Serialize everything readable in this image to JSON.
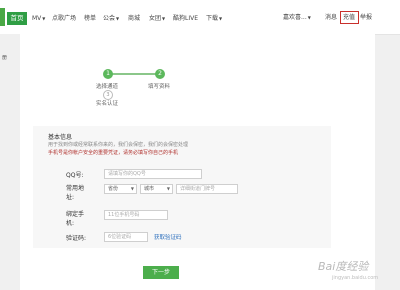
{
  "nav": {
    "home": "首页",
    "items": [
      "MV",
      "点歌广场",
      "榜单",
      "公会",
      "商城",
      "女团",
      "酷狗LIVE",
      "下载"
    ],
    "user": "嘉欢喜...",
    "message": "消息",
    "recharge": "充值",
    "report": "举报"
  },
  "page": {
    "side_label": "册"
  },
  "steps": [
    {
      "num": "1",
      "label": "选择通道"
    },
    {
      "num": "2",
      "label": "填写资料"
    },
    {
      "num": "3",
      "label": "实名认证"
    }
  ],
  "form": {
    "title": "基本信息",
    "desc": "用于找到你或经常联系你来的，我们会保密，我们的会保密处理",
    "warning": "手机号是你帐户安全的重要凭证，请务必填写你自己的手机",
    "qq_label": "QQ号:",
    "qq_placeholder": "请填写你的QQ号",
    "addr_label_1": "常用地",
    "addr_label_2": "址:",
    "province": "省份",
    "city": "城市",
    "addr_placeholder": "详细街道门牌号",
    "phone_label_1": "绑定手",
    "phone_label_2": "机:",
    "phone_placeholder": "11位手机号码",
    "code_label": "验证码:",
    "code_placeholder": "6位验证码",
    "get_code": "获取验证码",
    "next": "下一步"
  },
  "watermark": {
    "main": "Bai度经验",
    "sub": "jingyan.baidu.com"
  },
  "colors": {
    "brand_green": "#4cae4c",
    "warning_red": "#b0302c",
    "highlight_border": "#c9302c"
  }
}
